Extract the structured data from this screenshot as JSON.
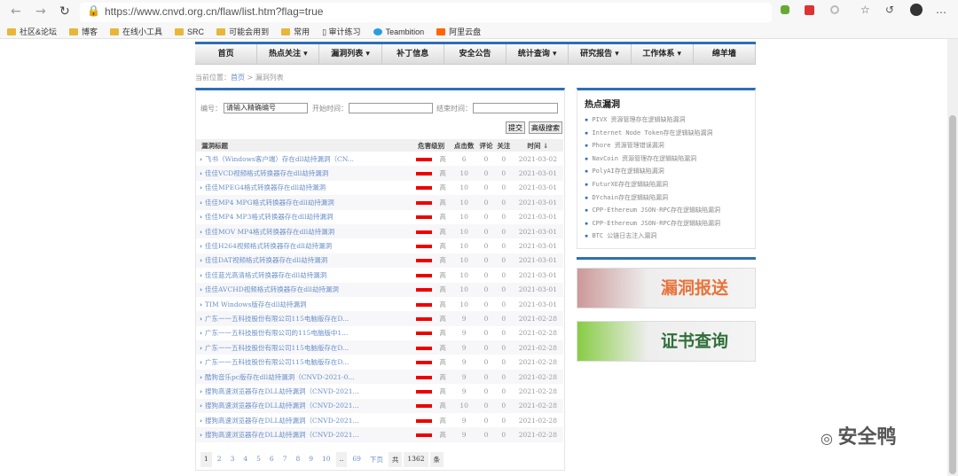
{
  "browser": {
    "url": "https://www.cnvd.org.cn/flaw/list.htm?flag=true",
    "bookmarks": [
      "社区&论坛",
      "博客",
      "在线小工具",
      "SRC",
      "可能会用到",
      "常用",
      "审计练习",
      "Teambition",
      "阿里云盘"
    ]
  },
  "nav": [
    "首页",
    "热点关注 ▾",
    "漏洞列表 ▾",
    "补丁信息",
    "安全公告",
    "统计查询 ▾",
    "研究报告 ▾",
    "工作体系 ▾",
    "绵羊墙"
  ],
  "breadcrumb": {
    "label": "当前位置：",
    "home": "首页",
    "sep": " > ",
    "current": "漏洞列表"
  },
  "search": {
    "id_label": "编号：",
    "id_value": "请输入精确编号",
    "start_label": "开始时间：",
    "end_label": "结束时间：",
    "submit": "提交",
    "advanced": "高级搜索"
  },
  "table": {
    "headers": [
      "漏洞标题",
      "危害级别",
      "点击数",
      "评论",
      "关注",
      "时间 ↓"
    ],
    "rows": [
      [
        "飞书（Windows客户端）存在dll劫持漏洞（CN...",
        "高",
        "6",
        "0",
        "0",
        "2021-03-02"
      ],
      [
        "佳佳VCD视频格式转换器存在dll劫持漏洞",
        "高",
        "10",
        "0",
        "0",
        "2021-03-01"
      ],
      [
        "佳佳MPEG4格式转换器存在dll劫持漏洞",
        "高",
        "10",
        "0",
        "0",
        "2021-03-01"
      ],
      [
        "佳佳MP4 MPG格式转换器存在dll劫持漏洞",
        "高",
        "10",
        "0",
        "0",
        "2021-03-01"
      ],
      [
        "佳佳MP4 MP3格式转换器存在dll劫持漏洞",
        "高",
        "10",
        "0",
        "0",
        "2021-03-01"
      ],
      [
        "佳佳MOV MP4格式转换器存在dll劫持漏洞",
        "高",
        "10",
        "0",
        "0",
        "2021-03-01"
      ],
      [
        "佳佳H264视频格式转换器存在dll劫持漏洞",
        "高",
        "10",
        "0",
        "0",
        "2021-03-01"
      ],
      [
        "佳佳DAT视频格式转换器存在dll劫持漏洞",
        "高",
        "10",
        "0",
        "0",
        "2021-03-01"
      ],
      [
        "佳佳蓝光高清格式转换器存在dll劫持漏洞",
        "高",
        "10",
        "0",
        "0",
        "2021-03-01"
      ],
      [
        "佳佳AVCHD视频格式转换器存在dll劫持漏洞",
        "高",
        "10",
        "0",
        "0",
        "2021-03-01"
      ],
      [
        "TIM Windows版存在dll劫持漏洞",
        "高",
        "10",
        "0",
        "0",
        "2021-03-01"
      ],
      [
        "广东一一五科技股份有限公司115电脑版存在D...",
        "高",
        "9",
        "0",
        "0",
        "2021-02-28"
      ],
      [
        "广东一一五科技股份有限公司的115电脑版中1...",
        "高",
        "9",
        "0",
        "0",
        "2021-02-28"
      ],
      [
        "广东一一五科技股份有限公司115电脑版存在D...",
        "高",
        "9",
        "0",
        "0",
        "2021-02-28"
      ],
      [
        "广东一一五科技股份有限公司115电脑版存在D...",
        "高",
        "9",
        "0",
        "0",
        "2021-02-28"
      ],
      [
        "酷狗音乐pc版存在dll劫持漏洞（CNVD-2021-0...",
        "高",
        "9",
        "0",
        "0",
        "2021-02-28"
      ],
      [
        "搜狗高速浏览器存在DLL劫持漏洞（CNVD-2021...",
        "高",
        "9",
        "0",
        "0",
        "2021-02-28"
      ],
      [
        "搜狗高速浏览器存在DLL劫持漏洞（CNVD-2021...",
        "高",
        "10",
        "0",
        "0",
        "2021-02-28"
      ],
      [
        "搜狗高速浏览器存在DLL劫持漏洞（CNVD-2021...",
        "高",
        "9",
        "0",
        "0",
        "2021-02-28"
      ],
      [
        "搜狗高速浏览器存在DLL劫持漏洞（CNVD-2021...",
        "高",
        "9",
        "0",
        "0",
        "2021-02-28"
      ]
    ]
  },
  "pager": {
    "pages": [
      "1",
      "2",
      "3",
      "4",
      "5",
      "6",
      "7",
      "8",
      "9",
      "10",
      "..",
      "69"
    ],
    "next": "下页",
    "total_prefix": "共",
    "total": "1362",
    "total_suffix": "条"
  },
  "hot": {
    "title": "热点漏洞",
    "items": [
      "PIVX 资源管理存在逻辑缺陷漏洞",
      "Internet Node Token存在逻辑缺陷漏洞",
      "Phore 资源管理错误漏洞",
      "NavCoin 资源管理存在逻辑缺陷漏洞",
      "PolyAI存在逻辑缺陷漏洞",
      "FuturXE存在逻辑缺陷漏洞",
      "DYchain存在逻辑缺陷漏洞",
      "CPP-Ethereum JSON-RPC存在逻辑缺陷漏洞",
      "CPP-Ethereum JSON-RPC存在逻辑缺陷漏洞",
      "BTC 公链日志注入漏洞"
    ]
  },
  "banners": {
    "report": "漏洞报送",
    "cert": "证书查询"
  },
  "watermark": "安全鸭"
}
